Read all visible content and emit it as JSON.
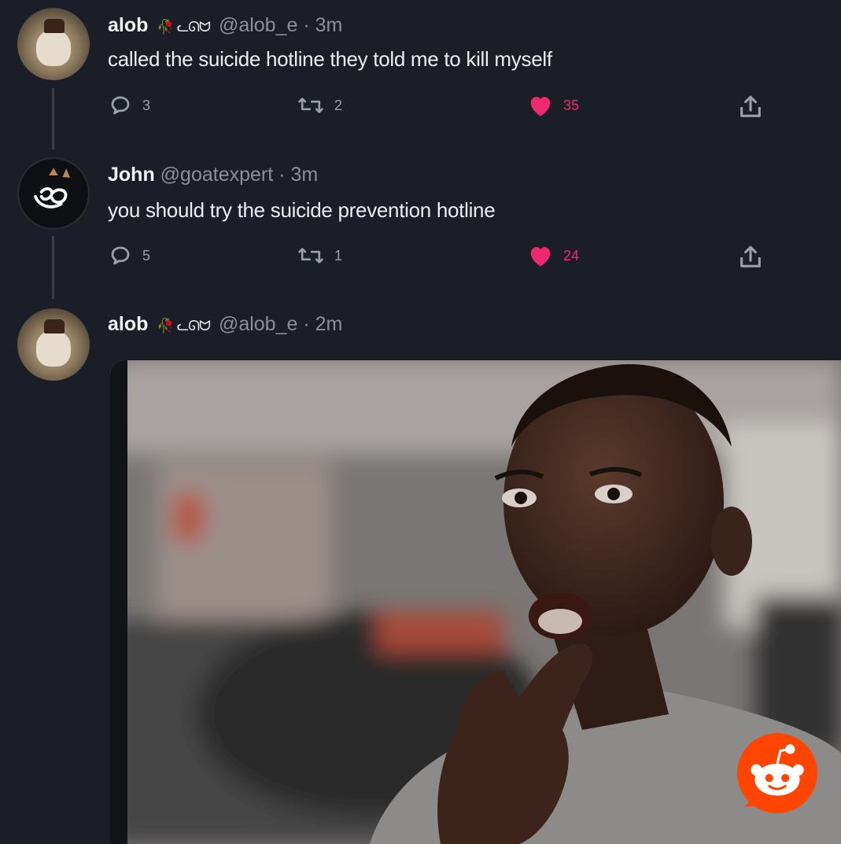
{
  "tweets": [
    {
      "name": "alob",
      "deco": "🥀 ᓚᘏᗢ",
      "handle": "@alob_e",
      "dot": "·",
      "time": "3m",
      "text": "called the suicide hotline they told me to kill myself",
      "replies": "3",
      "retweets": "2",
      "likes": "35"
    },
    {
      "name": "John",
      "handle": "@goatexpert",
      "dot": "·",
      "time": "3m",
      "text": "you should try the suicide prevention hotline",
      "replies": "5",
      "retweets": "1",
      "likes": "24"
    },
    {
      "name": "alob",
      "deco": "🥀 ᓚᘏᗢ",
      "handle": "@alob_e",
      "dot": "·",
      "time": "2m",
      "media": "reaction-gif"
    }
  ],
  "colors": {
    "background": "#1b1e27",
    "like": "#f0286d",
    "muted": "#8a8f98",
    "reddit": "#ff4500"
  },
  "icons": [
    "reply-icon",
    "retweet-icon",
    "like-icon",
    "share-icon",
    "reddit-logo"
  ]
}
